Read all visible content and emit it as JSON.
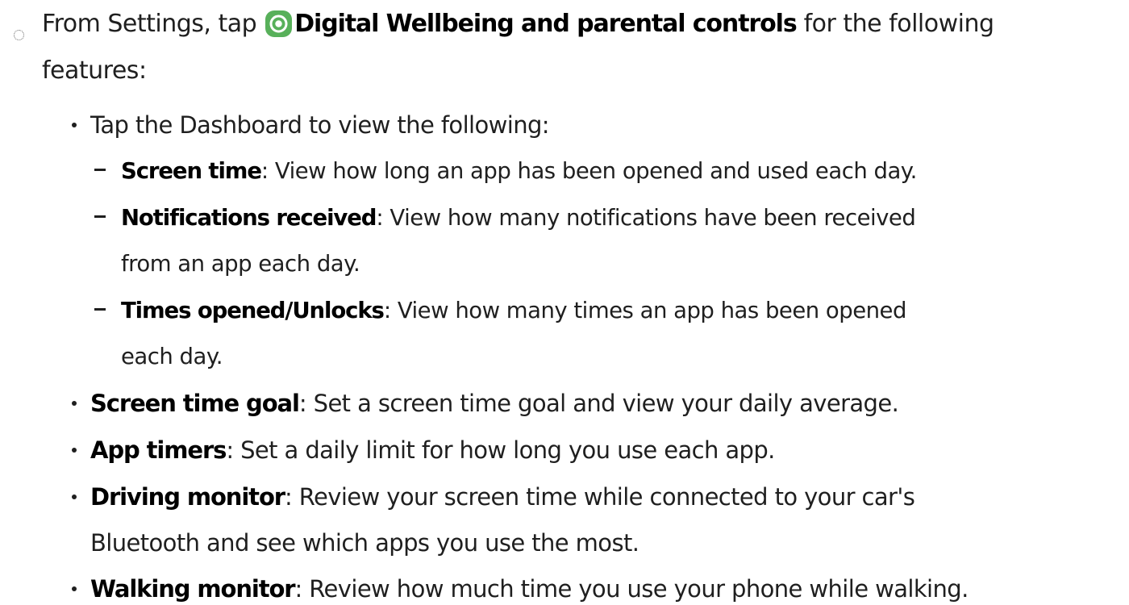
{
  "intro": {
    "prefix": "From Settings, tap ",
    "link": "Digital Wellbeing and parental controls",
    "suffix_line1": " for the following",
    "suffix_line2": "features:",
    "icon": "digital-wellbeing-icon"
  },
  "dashboard": {
    "text": "Tap the Dashboard to view the following:",
    "items": [
      {
        "term": "Screen time",
        "desc_line1": ": View how long an app has been opened and used each day."
      },
      {
        "term": "Notifications received",
        "desc_line1": ": View how many notifications have been received",
        "desc_line2": "from an app each day."
      },
      {
        "term": "Times opened/Unlocks",
        "desc_line1": ": View how many times an app has been opened",
        "desc_line2": "each day."
      }
    ]
  },
  "features": [
    {
      "term": "Screen time goal",
      "desc_line1": ": Set a screen time goal and view your daily average."
    },
    {
      "term": "App timers",
      "desc_line1": ": Set a daily limit for how long you use each app."
    },
    {
      "term": "Driving monitor",
      "desc_line1": ": Review your screen time while connected to your car's",
      "desc_line2": "Bluetooth and see which apps you use the most."
    },
    {
      "term": "Walking monitor",
      "desc_line1": ": Review how much time you use your phone while walking."
    }
  ],
  "colors": {
    "text": "#1f1f1f",
    "icon_bg": "#58b05a"
  }
}
